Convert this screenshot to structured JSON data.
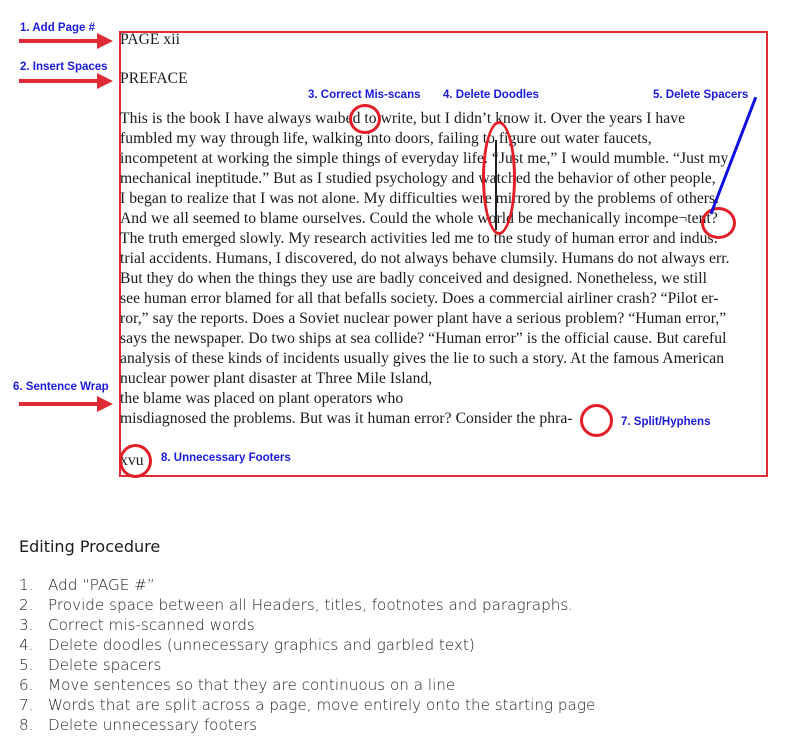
{
  "annotations": [
    {
      "label": "1. Add Page #"
    },
    {
      "label": "2. Insert Spaces"
    },
    {
      "label": "3. Correct Mis-scans"
    },
    {
      "label": "4. Delete Doodles"
    },
    {
      "label": "5. Delete Spacers"
    },
    {
      "label": "6. Sentence Wrap"
    },
    {
      "label": "7. Split/Hyphens"
    },
    {
      "label": "8. Unnecessary Footers"
    }
  ],
  "colors": {
    "annotation_text": "#1a1adb",
    "annotation_marks": "#e02a36",
    "spacer_pointer": "#1010e0"
  },
  "document": {
    "page_header": "PAGE xii",
    "title": "PREFACE",
    "lines": [
      "This is the book I have always waıbed to write, but I didn’t know it. Over the years I have",
      "fumbled my way through life, walking into doors, failing to figure out water faucets,",
      "incompetent at working the simple things of everyday life. “Just me,” I would mumble. “Just my",
      "mechanical ineptitude.” But as I studied psychology and watched the behavior of other people,",
      "I began to realize that I was not alone. My difficulties were mirrored by the problems of others.",
      "And we all seemed to blame ourselves. Could the whole world be mechanically incompe¬tent?",
      "The truth emerged slowly. My research activities led me to the study of human error and indus:",
      "trial accidents. Humans, I discovered, do not always behave clumsily. Humans do not always err.",
      "But they do when the things they use are badly conceived and designed. Nonetheless, we still",
      "see human error blamed for all that befalls society. Does a commercial airliner crash? “Pilot er-",
      "ror,” say the reports. Does a Soviet nuclear power plant have a serious problem? “Human error,”",
      "says the newspaper. Do two ships at sea collide? “Human error” is the official cause. But careful",
      "analysis of these kinds of incidents usually gives the lie to such a story. At the famous American",
      "nuclear power plant disaster at Three Mile Island,",
      "the blame was placed on plant operators who",
      "misdiagnosed the problems. But was it human error? Consider the phra-"
    ],
    "footer": "xvu"
  },
  "procedure": {
    "title": "Editing Procedure",
    "steps": [
      {
        "num": "1.",
        "text": "Add “PAGE #”"
      },
      {
        "num": "2.",
        "text": "Provide space between all Headers, titles, footnotes and paragraphs."
      },
      {
        "num": "3.",
        "text": "Correct mis-scanned words"
      },
      {
        "num": "4.",
        "text": "Delete doodles (unnecessary graphics and garbled text)"
      },
      {
        "num": "5.",
        "text": "Delete spacers"
      },
      {
        "num": "6.",
        "text": "Move sentences so that they are continuous on a line"
      },
      {
        "num": "7.",
        "text": "Words that are split across a page, move entirely onto the starting page"
      },
      {
        "num": "8.",
        "text": "Delete unnecessary footers"
      }
    ]
  }
}
